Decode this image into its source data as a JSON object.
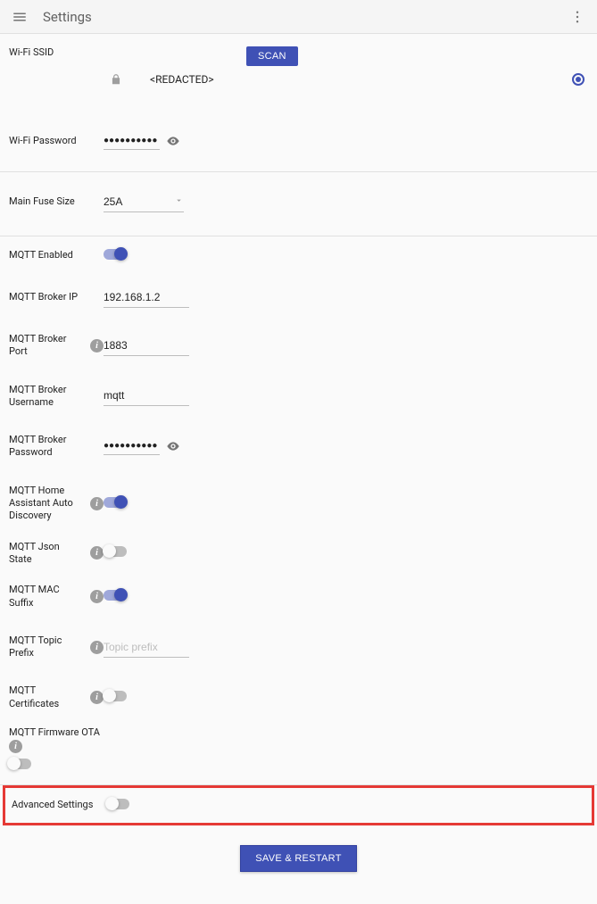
{
  "appbar": {
    "title": "Settings"
  },
  "wifi": {
    "ssid_label": "Wi-Fi SSID",
    "scan_label": "SCAN",
    "ssid_value": "<REDACTED>",
    "password_label": "Wi-Fi Password",
    "password_value": "●●●●●●●●●●"
  },
  "fuse": {
    "label": "Main Fuse Size",
    "value": "25A"
  },
  "mqtt": {
    "enabled_label": "MQTT Enabled",
    "enabled": true,
    "broker_ip_label": "MQTT Broker IP",
    "broker_ip": "192.168.1.2",
    "broker_port_label": "MQTT Broker Port",
    "broker_port": "1883",
    "username_label": "MQTT Broker Username",
    "username": "mqtt",
    "password_label": "MQTT Broker Password",
    "password": "●●●●●●●●●●",
    "ha_discovery_label": "MQTT Home Assistant Auto Discovery",
    "ha_discovery": true,
    "json_state_label": "MQTT Json State",
    "json_state": false,
    "mac_suffix_label": "MQTT MAC Suffix",
    "mac_suffix": true,
    "topic_prefix_label": "MQTT Topic Prefix",
    "topic_prefix_placeholder": "Topic prefix",
    "topic_prefix": "",
    "certificates_label": "MQTT Certificates",
    "certificates": false,
    "firmware_ota_label": "MQTT Firmware OTA",
    "firmware_ota": false
  },
  "advanced": {
    "label": "Advanced Settings",
    "enabled": false
  },
  "save_label": "SAVE & RESTART"
}
